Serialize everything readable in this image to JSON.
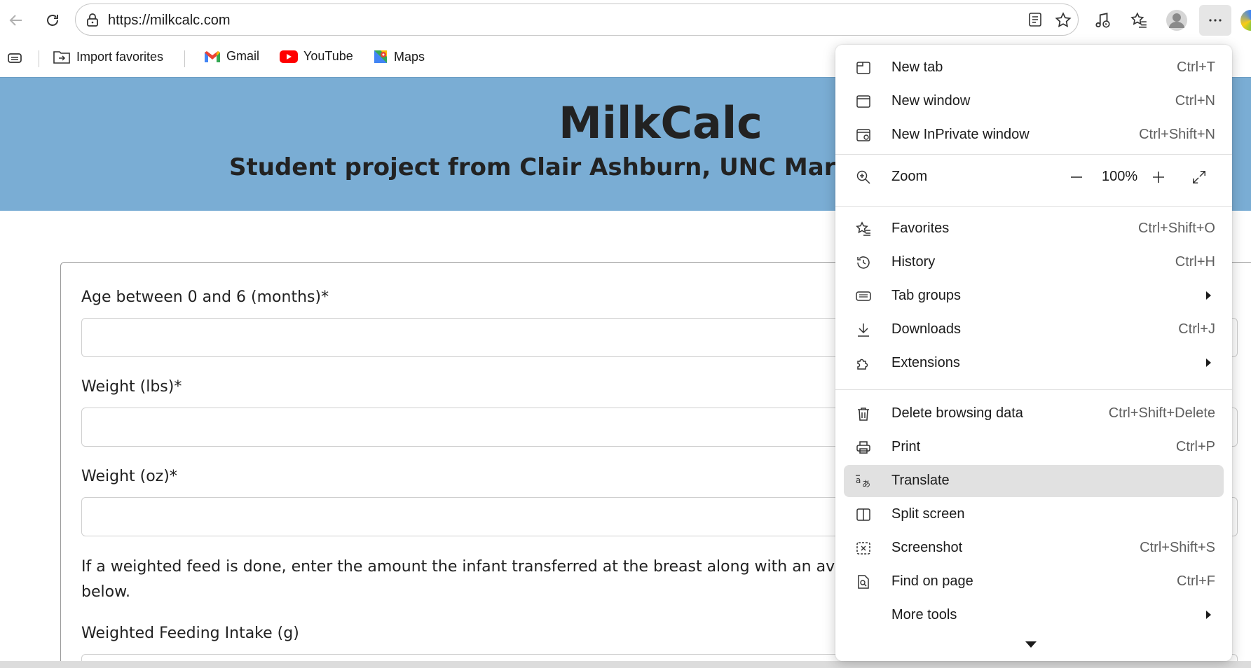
{
  "browser": {
    "url": "https://milkcalc.com"
  },
  "favorites_bar": {
    "items": [
      {
        "label": "Import favorites"
      },
      {
        "label": "Gmail"
      },
      {
        "label": "YouTube"
      },
      {
        "label": "Maps"
      }
    ]
  },
  "page": {
    "title": "MilkCalc",
    "subtitle": "Student project from Clair Ashburn, UNC Mary Rose T",
    "form": {
      "age_label": "Age between 0 and 6 (months)*",
      "weight_lbs_label": "Weight (lbs)*",
      "weight_oz_label": "Weight (oz)*",
      "instructions": "If a weighted feed is done, enter the amount the infant transferred at the breast along with an average",
      "instructions_cont": "below.",
      "weighted_intake_label": "Weighted Feeding Intake (g)"
    }
  },
  "menu": {
    "items": [
      {
        "label": "New tab",
        "shortcut": "Ctrl+T",
        "icon": "new-tab-icon"
      },
      {
        "label": "New window",
        "shortcut": "Ctrl+N",
        "icon": "new-window-icon"
      },
      {
        "label": "New InPrivate window",
        "shortcut": "Ctrl+Shift+N",
        "icon": "inprivate-icon"
      },
      {
        "label": "Zoom",
        "icon": "zoom-icon"
      },
      {
        "label": "Favorites",
        "shortcut": "Ctrl+Shift+O",
        "icon": "favorites-icon"
      },
      {
        "label": "History",
        "shortcut": "Ctrl+H",
        "icon": "history-icon"
      },
      {
        "label": "Tab groups",
        "icon": "tab-groups-icon"
      },
      {
        "label": "Downloads",
        "shortcut": "Ctrl+J",
        "icon": "downloads-icon"
      },
      {
        "label": "Extensions",
        "icon": "extensions-icon"
      },
      {
        "label": "Delete browsing data",
        "shortcut": "Ctrl+Shift+Delete",
        "icon": "delete-icon"
      },
      {
        "label": "Print",
        "shortcut": "Ctrl+P",
        "icon": "print-icon"
      },
      {
        "label": "Translate",
        "icon": "translate-icon"
      },
      {
        "label": "Split screen",
        "icon": "split-screen-icon"
      },
      {
        "label": "Screenshot",
        "shortcut": "Ctrl+Shift+S",
        "icon": "screenshot-icon"
      },
      {
        "label": "Find on page",
        "shortcut": "Ctrl+F",
        "icon": "find-icon"
      },
      {
        "label": "More tools"
      }
    ],
    "zoom_value": "100%"
  },
  "colors": {
    "hero": "#7aadd4",
    "menu_highlight": "#e1e1e1"
  }
}
